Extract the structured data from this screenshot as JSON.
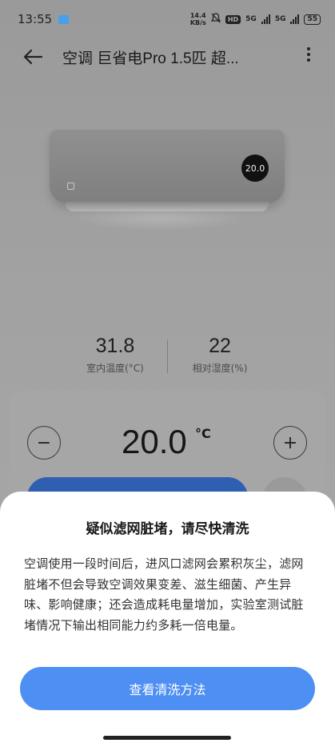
{
  "status_bar": {
    "time": "13:55",
    "net_speed_value": "14.4",
    "net_speed_unit": "KB/s",
    "hd_label": "HD",
    "sim1_label": "5G",
    "sim2_label": "5G",
    "battery": "55"
  },
  "header": {
    "back_icon": "arrow-left-icon",
    "title": "空调 巨省电Pro 1.5匹 超...",
    "more_icon": "more-vertical-icon"
  },
  "device": {
    "display_temp": "20.0"
  },
  "readings": [
    {
      "value": "31.8",
      "label": "室内温度(°C)"
    },
    {
      "value": "22",
      "label": "相对湿度(%)"
    }
  ],
  "control": {
    "minus_label": "−",
    "plus_label": "+",
    "set_temp": "20.0",
    "unit": "°C"
  },
  "sheet": {
    "title": "疑似滤网脏堵，请尽快清洗",
    "body": "空调使用一段时间后，进风口滤网会累积灰尘，滤网脏堵不但会导致空调效果变差、滋生细菌、产生异味、影响健康；还会造成耗电量增加，实验室测试脏堵情况下输出相同能力约多耗一倍电量。",
    "button_label": "查看清洗方法"
  },
  "colors": {
    "accent": "#4d8ff2",
    "scrim": "#a3a3a3",
    "sheet_bg": "#ffffff"
  }
}
